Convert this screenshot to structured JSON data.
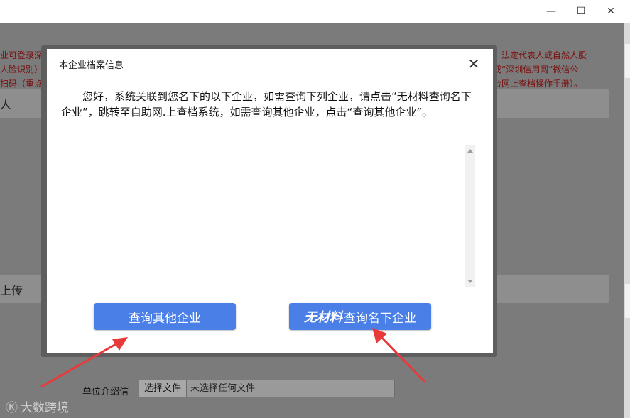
{
  "window": {
    "minimize_glyph": "—",
    "maximize_glyph": "☐",
    "close_glyph": "✕"
  },
  "background": {
    "notice_lines_left": [
      "业可登录深",
      "人脸识别）",
      "扫码（重点"
    ],
    "notice_lines_right": [
      "、法定代表人或自然人股",
      "或“深圳信用网”微信公",
      "台网上查档操作手册）。"
    ],
    "band1_label": "人",
    "band2_label": "上传",
    "upload_label": "单位介绍信",
    "file_button": "选择文件",
    "file_status": "未选择任何文件"
  },
  "watermark": {
    "logo": "Ⓚ",
    "text": "大数跨境"
  },
  "modal": {
    "title": "本企业档案信息",
    "close_glyph": "✕",
    "message": "您好，系统关联到您名下的以下企业，如需查询下列企业，请点击“无材料查询名下企业”，跳转至自助网.上查档系统，如需查询其他企业，点击“查询其他企业”。",
    "btn_other": "查询其他企业",
    "btn_nomat_prefix": "无材料",
    "btn_nomat_label": "查询名下企业"
  },
  "colors": {
    "button": "#4a7fe8",
    "notice_text": "#7a1010",
    "annotation_arrow": "#e83a3a"
  }
}
